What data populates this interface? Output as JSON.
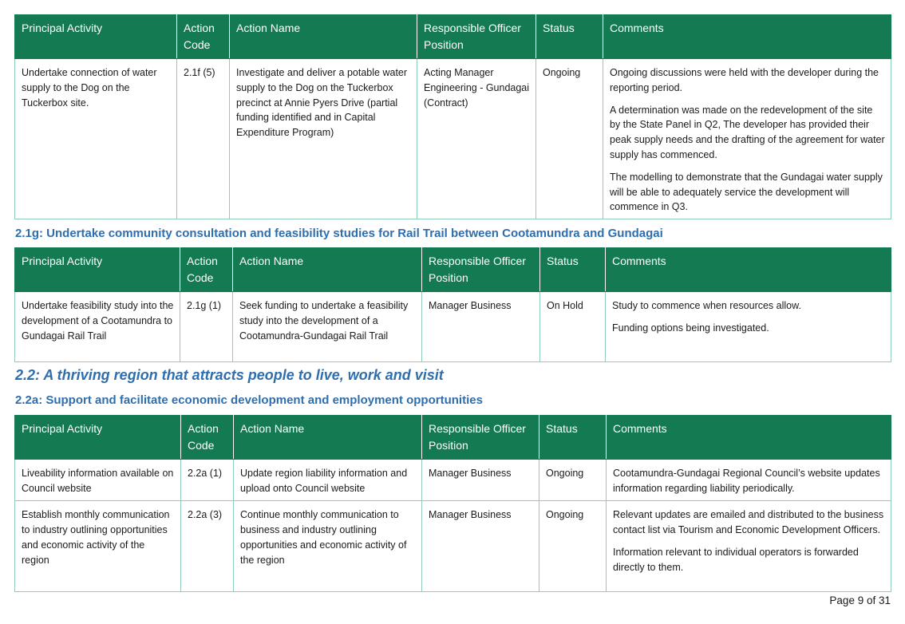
{
  "headers": {
    "principal_activity": "Principal Activity",
    "action_code": "Action Code",
    "action_name": "Action Name",
    "responsible_officer": "Responsible Officer Position",
    "status": "Status",
    "comments": "Comments"
  },
  "table1": {
    "row1": {
      "principal_activity": "Undertake connection of water supply to the Dog on the Tuckerbox site.",
      "action_code": "2.1f (5)",
      "action_name": "Investigate and deliver a potable water supply to the Dog on the Tuckerbox precinct at Annie Pyers Drive (partial funding identified and in Capital Expenditure Program)",
      "responsible_officer": "Acting Manager Engineering - Gundagai (Contract)",
      "status": "Ongoing",
      "comments": [
        "Ongoing discussions were held with the developer during the reporting period.",
        "A determination was made on the redevelopment of the site by the State Panel in Q2, The developer has provided their peak supply needs and the drafting of the agreement for water supply has commenced.",
        "The modelling to demonstrate that the Gundagai water supply will be able to adequately service the development will commence in Q3."
      ]
    }
  },
  "heading_2_1g": "2.1g: Undertake community consultation and feasibility studies for Rail Trail between Cootamundra and Gundagai",
  "table2": {
    "row1": {
      "principal_activity": "Undertake feasibility study into the development of a Cootamundra to Gundagai Rail Trail",
      "action_code": "2.1g (1)",
      "action_name": "Seek funding to undertake a feasibility study into the development of a Cootamundra-Gundagai Rail Trail",
      "responsible_officer": "Manager Business",
      "status": "On Hold",
      "comments": [
        "Study to commence when resources allow.",
        "Funding options being investigated."
      ]
    }
  },
  "heading_2_2": "2.2: A thriving region that attracts people to live, work and visit",
  "heading_2_2a": "2.2a: Support and facilitate economic development and employment opportunities",
  "table3": {
    "row1": {
      "principal_activity": "Liveability information available on Council website",
      "action_code": "2.2a (1)",
      "action_name": "Update region liability information and upload onto Council website",
      "responsible_officer": "Manager Business",
      "status": "Ongoing",
      "comments": [
        "Cootamundra-Gundagai Regional Council’s website updates information regarding liability periodically."
      ]
    },
    "row2": {
      "principal_activity": "Establish monthly communication to industry outlining opportunities and economic activity of the region",
      "action_code": "2.2a (3)",
      "action_name": "Continue monthly communication to business and industry outlining opportunities and economic activity of the region",
      "responsible_officer": "Manager Business",
      "status": "Ongoing",
      "comments": [
        "Relevant updates are emailed and distributed to the business contact list via Tourism and Economic Development Officers.",
        "Information relevant to individual operators is forwarded directly to them."
      ]
    }
  },
  "footer": {
    "page_label": "Page 9 of 31"
  },
  "colors": {
    "header_bg": "#137a51",
    "heading_text": "#2f6ead",
    "table_border": "#8fcdb6"
  }
}
